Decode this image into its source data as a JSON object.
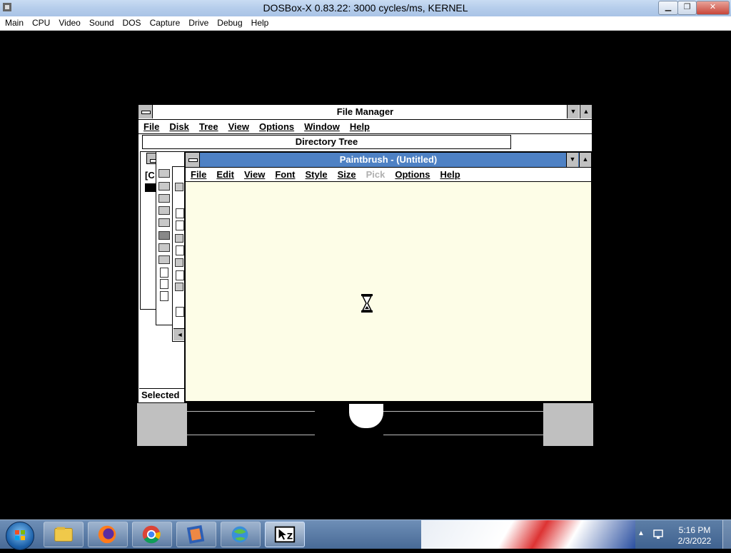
{
  "host": {
    "title": "DOSBox-X 0.83.22: 3000 cycles/ms, KERNEL",
    "menu": [
      "Main",
      "CPU",
      "Video",
      "Sound",
      "DOS",
      "Capture",
      "Drive",
      "Debug",
      "Help"
    ],
    "minimize_glyph": "▁",
    "restore_glyph": "❐",
    "close_glyph": "✕"
  },
  "file_manager": {
    "title": "File Manager",
    "menu": [
      "File",
      "Disk",
      "Tree",
      "View",
      "Options",
      "Window",
      "Help"
    ],
    "directory_tree_title": "Directory Tree",
    "drive_label": "[C",
    "status_selected": "Selected",
    "scroll_down_glyph": "▼",
    "scroll_up_glyph": "▲",
    "left_arrow_glyph": "◄"
  },
  "paintbrush": {
    "title": "Paintbrush - (Untitled)",
    "menu": [
      "File",
      "Edit",
      "View",
      "Font",
      "Style",
      "Size",
      "Pick",
      "Options",
      "Help"
    ],
    "disabled_menu": "Pick",
    "cursor": "hourglass-icon"
  },
  "taskbar": {
    "clock_time": "5:16 PM",
    "clock_date": "2/3/2022",
    "pinned": [
      "windows-explorer-icon",
      "firefox-icon",
      "chrome-icon",
      "dosbox-icon",
      "network-globe-icon",
      "dosbox-x-app-icon"
    ],
    "tray_up_glyph": "▲"
  },
  "colors": {
    "active_titlebar": "#4e81c4",
    "canvas": "#fdfde7",
    "taskbar": "#3f6290"
  }
}
